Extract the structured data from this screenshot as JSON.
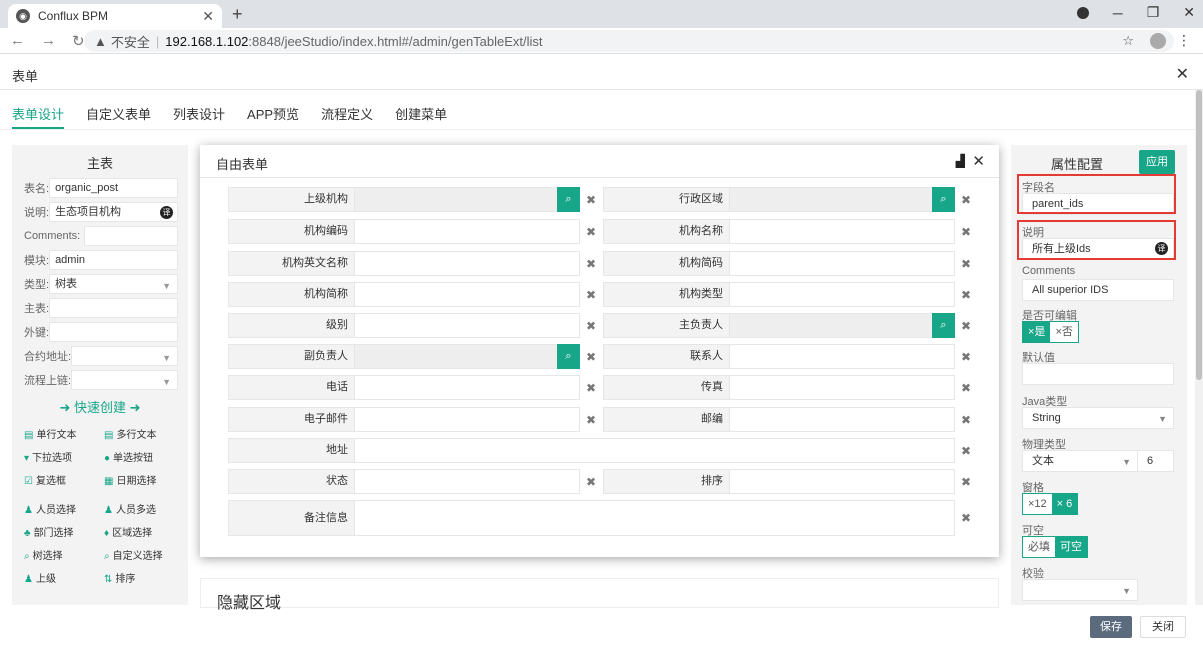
{
  "browser": {
    "tab_title": "Conflux BPM",
    "insecure_label": "不安全",
    "url_host": "192.168.1.102",
    "url_path": ":8848/jeeStudio/index.html#/admin/genTableExt/list"
  },
  "app": {
    "header_title": "表单",
    "tabs": [
      "表单设计",
      "自定义表单",
      "列表设计",
      "APP预览",
      "流程定义",
      "创建菜单"
    ]
  },
  "left": {
    "title": "主表",
    "fields": [
      {
        "label": "表名:",
        "value": "organic_post"
      },
      {
        "label": "说明:",
        "value": "生态项目机构"
      },
      {
        "label": "Comments:",
        "value": ""
      },
      {
        "label": "模块:",
        "value": "admin"
      },
      {
        "label": "类型:",
        "value": "树表"
      },
      {
        "label": "主表:",
        "value": ""
      },
      {
        "label": "外键:",
        "value": ""
      },
      {
        "label": "合约地址:",
        "value": ""
      },
      {
        "label": "流程上链:",
        "value": ""
      }
    ],
    "quick_create": "快速创建",
    "widgets": [
      "单行文本",
      "多行文本",
      "下拉选项",
      "单选按钮",
      "复选框",
      "日期选择",
      "人员选择",
      "人员多选",
      "部门选择",
      "区域选择",
      "树选择",
      "自定义选择",
      "上级",
      "排序"
    ]
  },
  "modal": {
    "title": "自由表单",
    "fields": [
      {
        "label": "上级机构",
        "search": true
      },
      {
        "label": "行政区域",
        "search": true
      },
      {
        "label": "机构编码",
        "search": false
      },
      {
        "label": "机构名称",
        "search": false
      },
      {
        "label": "机构英文名称",
        "search": false
      },
      {
        "label": "机构简码",
        "search": false
      },
      {
        "label": "机构简称",
        "search": false
      },
      {
        "label": "机构类型",
        "search": false
      },
      {
        "label": "级别",
        "search": false
      },
      {
        "label": "主负责人",
        "search": true
      },
      {
        "label": "副负责人",
        "search": true
      },
      {
        "label": "联系人",
        "search": false
      },
      {
        "label": "电话",
        "search": false
      },
      {
        "label": "传真",
        "search": false
      },
      {
        "label": "电子邮件",
        "search": false
      },
      {
        "label": "邮编",
        "search": false
      },
      {
        "label": "地址",
        "search": false
      },
      {
        "label": "状态",
        "search": false
      },
      {
        "label": "排序",
        "search": false
      },
      {
        "label": "备注信息",
        "search": false
      }
    ]
  },
  "hidden_area": "隐藏区域",
  "right": {
    "title": "属性配置",
    "apply": "应用",
    "field_name_label": "字段名",
    "field_name": "parent_ids",
    "desc_label": "说明",
    "desc": "所有上级Ids",
    "comments_label": "Comments",
    "comments": "All superior IDS",
    "editable_label": "是否可编辑",
    "editable_yes": "×是",
    "editable_no": "×否",
    "default_label": "默认值",
    "default_value": "",
    "java_type_label": "Java类型",
    "java_type": "String",
    "phys_type_label": "物理类型",
    "phys_type": "文本",
    "phys_len": "6",
    "grid_label": "窗格",
    "grid_12": "×12",
    "grid_6": "× 6",
    "nullable_label": "可空",
    "required": "必填",
    "nullable": "可空",
    "validate_label": "校验"
  },
  "footer": {
    "save": "保存",
    "close": "关闭"
  }
}
